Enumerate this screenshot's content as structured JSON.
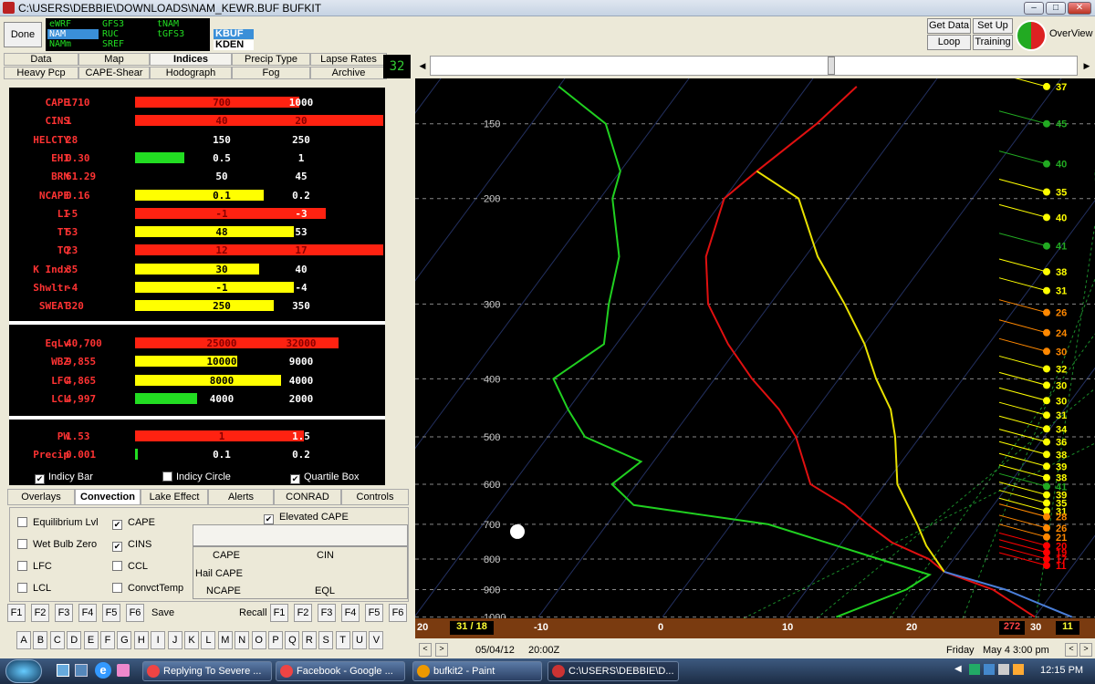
{
  "window": {
    "title": "C:\\USERS\\DEBBIE\\DOWNLOADS\\NAM_KEWR.BUF BUFKIT"
  },
  "topbar": {
    "done": "Done",
    "models": [
      {
        "label": "eWRF",
        "selected": false
      },
      {
        "label": "GFS3",
        "selected": false
      },
      {
        "label": "tNAM",
        "selected": false
      },
      {
        "label": "NAM",
        "selected": true
      },
      {
        "label": "RUC",
        "selected": false
      },
      {
        "label": "tGFS3",
        "selected": false
      },
      {
        "label": "NAMm",
        "selected": false
      },
      {
        "label": "SREF",
        "selected": false
      }
    ],
    "stations": [
      {
        "label": "KBUF",
        "selected": true
      },
      {
        "label": "KDEN",
        "selected": false
      }
    ],
    "get_data": "Get Data",
    "setup": "Set Up",
    "loop": "Loop",
    "training": "Training",
    "overview": "OverView"
  },
  "tabs": {
    "row1": [
      "Data",
      "Map",
      "Indices",
      "Precip Type",
      "Lapse Rates"
    ],
    "row2": [
      "Heavy Pcp",
      "CAPE-Shear",
      "Hodograph",
      "Fog",
      "Archive"
    ],
    "active": "Indices",
    "count": "32"
  },
  "indices": {
    "group1": [
      {
        "label": "CAPE",
        "value": "1710",
        "q1": "700",
        "q2": "1000",
        "bar_color": "#f21",
        "bar_fraction": 0.66
      },
      {
        "label": "CINS",
        "value": "1",
        "q1": "40",
        "q2": "20",
        "bar_color": "#f21",
        "bar_fraction": 1.0
      },
      {
        "label": "HELCTY",
        "value": "28",
        "q1": "150",
        "q2": "250",
        "bar_color": "",
        "bar_fraction": 0
      },
      {
        "label": "EHI",
        "value": "0.30",
        "q1": "0.5",
        "q2": "1",
        "bar_color": "#2d2",
        "bar_fraction": 0.2
      },
      {
        "label": "BRN",
        "value": "61.29",
        "q1": "50",
        "q2": "45",
        "bar_color": "",
        "bar_fraction": 0
      },
      {
        "label": "NCAPE",
        "value": "0.16",
        "q1": "0.1",
        "q2": "0.2",
        "bar_color": "#ff0",
        "bar_fraction": 0.52
      },
      {
        "label": "LI",
        "value": "-5",
        "q1": "-1",
        "q2": "-3",
        "bar_color": "#f21",
        "bar_fraction": 0.77
      },
      {
        "label": "TT",
        "value": "53",
        "q1": "48",
        "q2": "53",
        "bar_color": "#ff0",
        "bar_fraction": 0.64
      },
      {
        "label": "TQ",
        "value": "23",
        "q1": "12",
        "q2": "17",
        "bar_color": "#f21",
        "bar_fraction": 1.0
      },
      {
        "label": "K Indx",
        "value": "35",
        "q1": "30",
        "q2": "40",
        "bar_color": "#ff0",
        "bar_fraction": 0.5
      },
      {
        "label": "Shwltr",
        "value": "-4",
        "q1": "-1",
        "q2": "-4",
        "bar_color": "#ff0",
        "bar_fraction": 0.64
      },
      {
        "label": "SWEAT",
        "value": "320",
        "q1": "250",
        "q2": "350",
        "bar_color": "#ff0",
        "bar_fraction": 0.56
      }
    ],
    "group2": [
      {
        "label": "EqLv",
        "value": "40,700",
        "q1": "25000",
        "q2": "32000",
        "bar_color": "#f21",
        "bar_fraction": 0.82
      },
      {
        "label": "WBZ",
        "value": "9,855",
        "q1": "10000",
        "q2": "9000",
        "bar_color": "#ff0",
        "bar_fraction": 0.41
      },
      {
        "label": "LFC",
        "value": "4,865",
        "q1": "8000",
        "q2": "4000",
        "bar_color": "#ff0",
        "bar_fraction": 0.59
      },
      {
        "label": "LCL",
        "value": "4,997",
        "q1": "4000",
        "q2": "2000",
        "bar_color": "#2d2",
        "bar_fraction": 0.25
      }
    ],
    "group3": [
      {
        "label": "PW",
        "value": "1.53",
        "q1": "1",
        "q2": "1.5",
        "bar_color": "#f21",
        "bar_fraction": 0.68
      },
      {
        "label": "Precip",
        "value": "0.001",
        "q1": "0.1",
        "q2": "0.2",
        "bar_color": "#2d2",
        "bar_fraction": 0.01
      }
    ],
    "checks": [
      {
        "label": "Indicy Bar",
        "checked": true
      },
      {
        "label": "Indicy Circle",
        "checked": false
      },
      {
        "label": "Quartile Box",
        "checked": true
      }
    ]
  },
  "bottom_tabs": [
    "Overlays",
    "Convection",
    "Lake Effect",
    "Alerts",
    "CONRAD",
    "Controls"
  ],
  "bottom_active": "Convection",
  "options": {
    "left": [
      {
        "label": "Equilibrium Lvl",
        "checked": false
      },
      {
        "label": "Wet Bulb Zero",
        "checked": false
      },
      {
        "label": "LFC",
        "checked": false
      },
      {
        "label": "LCL",
        "checked": false
      }
    ],
    "mid": [
      {
        "label": "CAPE",
        "checked": true
      },
      {
        "label": "CINS",
        "checked": true
      },
      {
        "label": "CCL",
        "checked": false
      },
      {
        "label": "ConvctTemp",
        "checked": false
      }
    ],
    "elevated": {
      "label": "Elevated CAPE",
      "checked": true
    },
    "readouts": {
      "cape": "CAPE",
      "cin": "CIN",
      "hail": "Hail CAPE",
      "ncape": "NCAPE",
      "eql": "EQL"
    }
  },
  "fkeys": {
    "left": [
      "F1",
      "F2",
      "F3",
      "F4",
      "F5",
      "F6"
    ],
    "save": "Save",
    "recall": "Recall",
    "right": [
      "F1",
      "F2",
      "F3",
      "F4",
      "F5",
      "F6"
    ]
  },
  "letters": [
    "A",
    "B",
    "C",
    "D",
    "E",
    "F",
    "G",
    "H",
    "I",
    "J",
    "K",
    "L",
    "M",
    "N",
    "O",
    "P",
    "Q",
    "R",
    "S",
    "T",
    "U",
    "V"
  ],
  "chart_data": {
    "type": "line",
    "pressure_levels": [
      150,
      200,
      300,
      400,
      500,
      600,
      700,
      800,
      900,
      1000
    ],
    "temperature_ticks": [
      "-10",
      "0",
      "10",
      "20"
    ],
    "series": [
      {
        "color": "#e01010",
        "points": [
          [
            -16,
            130
          ],
          [
            -17,
            150
          ],
          [
            -19,
            180
          ],
          [
            -20,
            200
          ],
          [
            -18,
            250
          ],
          [
            -15,
            300
          ],
          [
            -11,
            350
          ],
          [
            -7,
            400
          ],
          [
            -3,
            450
          ],
          [
            0,
            500
          ],
          [
            4,
            600
          ],
          [
            8,
            650
          ],
          [
            11,
            700
          ],
          [
            14,
            750
          ],
          [
            18,
            800
          ],
          [
            20,
            840
          ],
          [
            25,
            900
          ],
          [
            30,
            1000
          ]
        ]
      },
      {
        "color": "#e8e000",
        "points": [
          [
            -19,
            180
          ],
          [
            -14,
            200
          ],
          [
            -9,
            250
          ],
          [
            -4,
            300
          ],
          [
            0,
            350
          ],
          [
            3,
            400
          ],
          [
            6,
            450
          ],
          [
            8,
            500
          ],
          [
            11,
            600
          ],
          [
            15,
            700
          ],
          [
            17,
            760
          ],
          [
            20,
            840
          ]
        ]
      },
      {
        "color": "#20d020",
        "points": [
          [
            -40,
            130
          ],
          [
            -34,
            150
          ],
          [
            -30,
            180
          ],
          [
            -29,
            200
          ],
          [
            -25,
            250
          ],
          [
            -23,
            300
          ],
          [
            -21,
            350
          ],
          [
            -23,
            400
          ],
          [
            -20,
            450
          ],
          [
            -17,
            500
          ],
          [
            -11,
            550
          ],
          [
            -12,
            600
          ],
          [
            -9,
            650
          ],
          [
            3,
            700
          ],
          [
            14,
            800
          ],
          [
            19,
            850
          ],
          [
            18,
            900
          ],
          [
            14,
            1000
          ]
        ]
      },
      {
        "color": "#4a7ed8",
        "points": [
          [
            20,
            840
          ],
          [
            26,
            900
          ],
          [
            33,
            1000
          ]
        ]
      }
    ],
    "axis_left_label": "20",
    "axis_box_left": "31 / 18",
    "axis_box_right": "272",
    "axis_right_value": "30",
    "axis_right_box": "11",
    "wind_speeds": [
      {
        "p": 130,
        "v": "37",
        "c": "#ff0"
      },
      {
        "p": 150,
        "v": "45",
        "c": "#2a2"
      },
      {
        "p": 175,
        "v": "40",
        "c": "#2a2"
      },
      {
        "p": 195,
        "v": "35",
        "c": "#ff0"
      },
      {
        "p": 215,
        "v": "40",
        "c": "#ff0"
      },
      {
        "p": 240,
        "v": "41",
        "c": "#2a2"
      },
      {
        "p": 265,
        "v": "38",
        "c": "#ff0"
      },
      {
        "p": 285,
        "v": "31",
        "c": "#ff0"
      },
      {
        "p": 310,
        "v": "26",
        "c": "#f80"
      },
      {
        "p": 335,
        "v": "24",
        "c": "#f80"
      },
      {
        "p": 360,
        "v": "30",
        "c": "#f80"
      },
      {
        "p": 385,
        "v": "32",
        "c": "#ff0"
      },
      {
        "p": 410,
        "v": "30",
        "c": "#ff0"
      },
      {
        "p": 435,
        "v": "30",
        "c": "#ff0"
      },
      {
        "p": 460,
        "v": "31",
        "c": "#ff0"
      },
      {
        "p": 485,
        "v": "34",
        "c": "#ff0"
      },
      {
        "p": 510,
        "v": "36",
        "c": "#ff0"
      },
      {
        "p": 535,
        "v": "38",
        "c": "#ff0"
      },
      {
        "p": 560,
        "v": "39",
        "c": "#ff0"
      },
      {
        "p": 585,
        "v": "38",
        "c": "#ff0"
      },
      {
        "p": 605,
        "v": "41",
        "c": "#2a2"
      },
      {
        "p": 625,
        "v": "39",
        "c": "#ff0"
      },
      {
        "p": 645,
        "v": "35",
        "c": "#ff0"
      },
      {
        "p": 665,
        "v": "31",
        "c": "#ff0"
      },
      {
        "p": 680,
        "v": "28",
        "c": "#f80"
      },
      {
        "p": 710,
        "v": "26",
        "c": "#f80"
      },
      {
        "p": 735,
        "v": "21",
        "c": "#f80"
      },
      {
        "p": 760,
        "v": "20",
        "c": "#f00"
      },
      {
        "p": 780,
        "v": "19",
        "c": "#f00"
      },
      {
        "p": 800,
        "v": "17",
        "c": "#f00"
      },
      {
        "p": 820,
        "v": "11",
        "c": "#f00"
      }
    ]
  },
  "status": {
    "date": "05/04/12",
    "time": "20:00Z",
    "day": "Friday",
    "local": "May 4  3:00 pm"
  },
  "taskbar": {
    "items": [
      "Replying To Severe ...",
      "Facebook - Google ...",
      "bufkit2 - Paint",
      "C:\\USERS\\DEBBIE\\D..."
    ],
    "clock": "12:15 PM"
  }
}
